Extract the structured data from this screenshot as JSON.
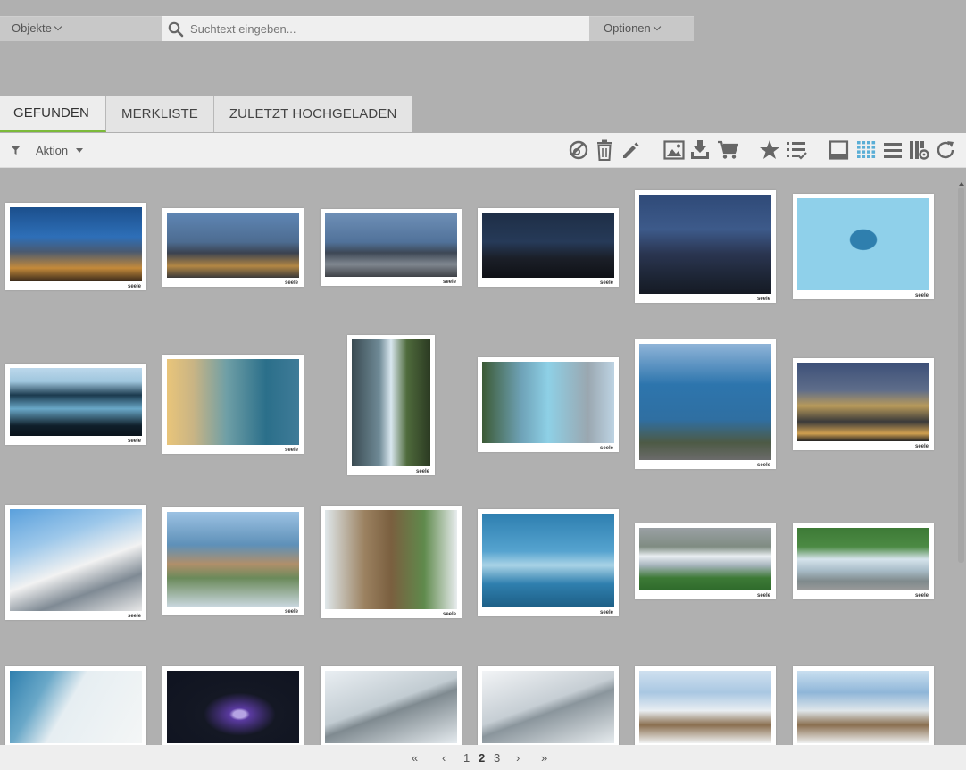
{
  "search": {
    "objects_label": "Objekte",
    "placeholder": "Suchtext eingeben...",
    "options_label": "Optionen"
  },
  "tabs": [
    {
      "label": "GEFUNDEN",
      "active": true
    },
    {
      "label": "MERKLISTE",
      "active": false
    },
    {
      "label": "ZULETZT HOCHGELADEN",
      "active": false
    }
  ],
  "toolbar": {
    "filter_icon": "filter-icon",
    "action_label": "Aktion",
    "icons": [
      "unlink-icon",
      "trash-icon",
      "edit-icon",
      "image-icon",
      "download-icon",
      "cart-icon",
      "star-icon",
      "list-check-icon",
      "single-view-icon",
      "grid-view-icon",
      "list-view-icon",
      "columns-settings-icon",
      "refresh-icon"
    ],
    "active_icon": "grid-view-icon",
    "active_color": "#5aaed6"
  },
  "gallery": {
    "brand_label": "seele",
    "accent_color": "#7cba3a"
  },
  "pager": {
    "first": "«",
    "prev": "‹",
    "pages": [
      "1",
      "2",
      "3"
    ],
    "current_page": "2",
    "next": "›",
    "last": "»"
  }
}
